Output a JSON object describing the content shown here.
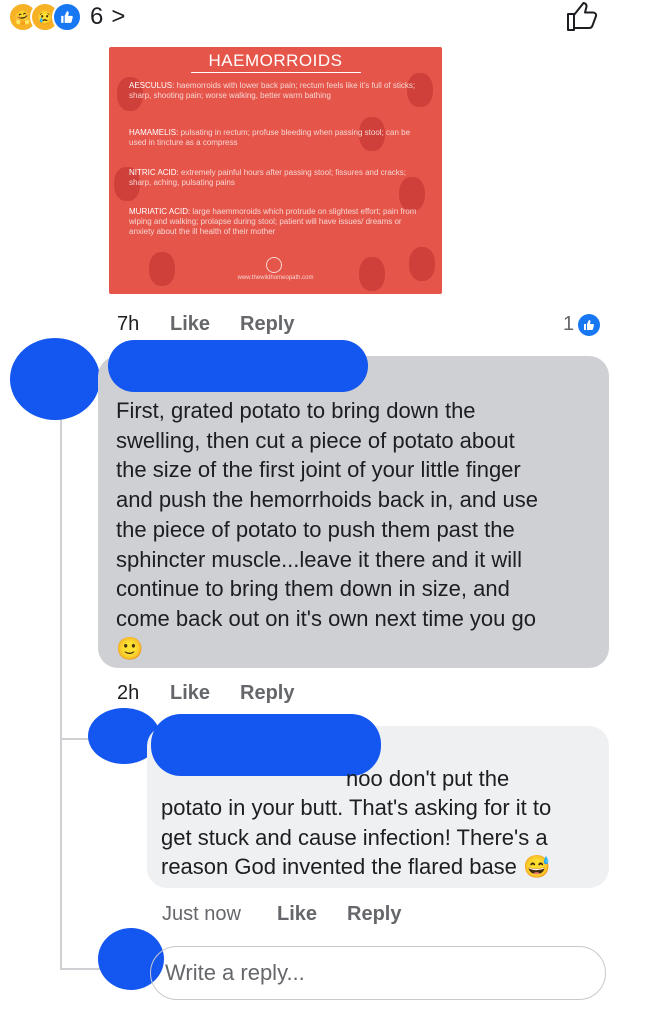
{
  "top": {
    "reaction_count": "6",
    "chevron": ">",
    "reaction_icons": [
      "care-icon",
      "sad-icon",
      "like-icon"
    ]
  },
  "card": {
    "title": "HAEMORROIDS",
    "items": [
      {
        "name": "AESCULUS:",
        "text": " haemorroids with lower back pain; rectum feels like it's full of sticks; sharp, shooting pain; worse walking, better warm bathing"
      },
      {
        "name": "HAMAMELIS:",
        "text": " pulsating in rectum; profuse bleeding when passing stool; can be used in tincture as a compress"
      },
      {
        "name": "NITRIC ACID:",
        "text": " extremely painful hours after passing stool; fissures and cracks; sharp, aching, pulsating pains"
      },
      {
        "name": "MURIATIC ACID:",
        "text": " large haemmoroids which protrude on slightest effort; pain from wiping and walking; prolapse during stool; patient will have issues/ dreams or anxiety about the ill health of their mother"
      }
    ],
    "url": "www.thewildhomeopath.com"
  },
  "post_actions": {
    "time": "7h",
    "like": "Like",
    "reply": "Reply",
    "like_count": "1"
  },
  "comment1": {
    "lines": [
      "First, grated potato to bring down the",
      "swelling, then cut a piece of potato about",
      "the size of the first joint of your little finger",
      "and push the hemorrhoids back in, and use",
      "the piece of potato to push them past the",
      "sphincter muscle...leave it there and it will",
      "continue to bring them down in size, and",
      "come back out on it's own next time you go"
    ],
    "emoji": "🙂",
    "time": "2h",
    "like": "Like",
    "reply": "Reply"
  },
  "comment2": {
    "lines": [
      "noo don't put the",
      "potato in your butt. That's asking for it to",
      "get stuck and cause infection! There's a",
      "reason God invented the flared base"
    ],
    "emoji": "😅",
    "time": "Just now",
    "like": "Like",
    "reply": "Reply"
  },
  "reply_input": {
    "placeholder": "Write a reply..."
  },
  "colors": {
    "accent": "#1877f2",
    "redaction": "#1356f0",
    "card_bg": "#e6554a",
    "bubble1": "#cfd0d3",
    "bubble2": "#eff0f2"
  }
}
